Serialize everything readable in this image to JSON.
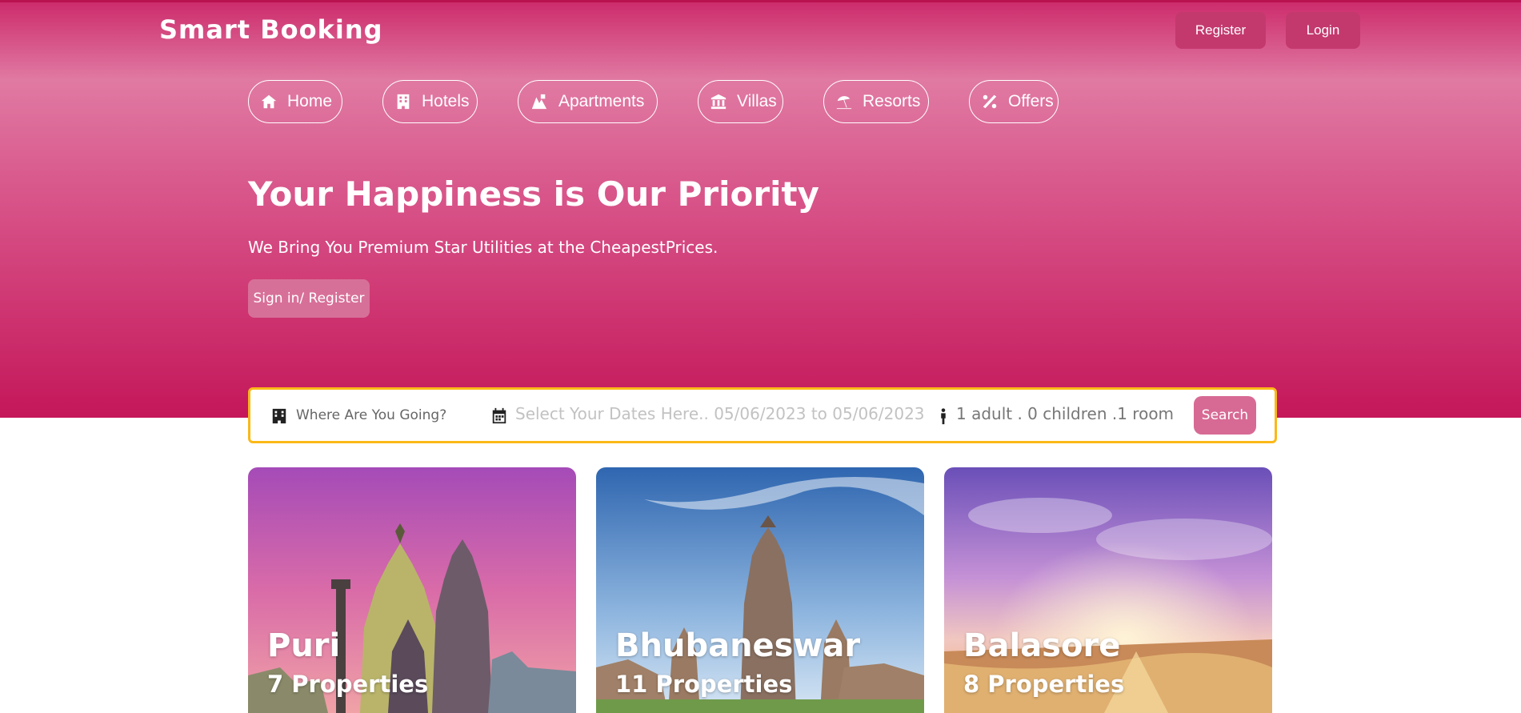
{
  "header": {
    "logo": "Smart Booking",
    "register_label": "Register",
    "login_label": "Login"
  },
  "nav": {
    "items": [
      {
        "label": "Home",
        "icon": "home-icon"
      },
      {
        "label": "Hotels",
        "icon": "hotel-building-icon"
      },
      {
        "label": "Apartments",
        "icon": "apartments-icon"
      },
      {
        "label": "Villas",
        "icon": "villa-columns-icon"
      },
      {
        "label": "Resorts",
        "icon": "umbrella-beach-icon"
      },
      {
        "label": "Offers",
        "icon": "percent-icon"
      }
    ]
  },
  "hero": {
    "headline": "Your Happiness is Our Priority",
    "subline": "We Bring You Premium Star Utilities at the CheapestPrices.",
    "cta_label": "Sign in/ Register"
  },
  "search": {
    "destination_placeholder": "Where Are You Going?",
    "dates_text": "Select Your Dates Here..  05/06/2023 to 05/06/2023",
    "guests_text": "1 adult . 0 children .1 room",
    "search_label": "Search"
  },
  "destinations": [
    {
      "city": "Puri",
      "properties": "7 Properties"
    },
    {
      "city": "Bhubaneswar",
      "properties": "11 Properties"
    },
    {
      "city": "Balasore",
      "properties": "8 Properties"
    }
  ],
  "colors": {
    "hero_gradient_top": "#cc2a6a",
    "hero_gradient_bottom": "#c4175a",
    "button_bg": "#c3396e",
    "search_border": "#fbb818",
    "search_button": "#d76a94"
  }
}
